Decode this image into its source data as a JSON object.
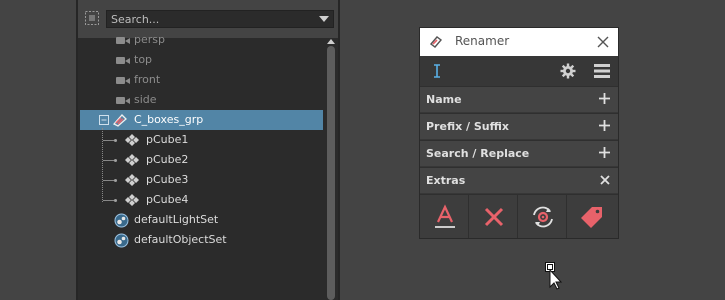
{
  "outliner": {
    "search": {
      "placeholder": "Search..."
    },
    "items": [
      {
        "label": "persp",
        "kind": "camera",
        "dim": true
      },
      {
        "label": "top",
        "kind": "camera",
        "dim": true
      },
      {
        "label": "front",
        "kind": "camera",
        "dim": true
      },
      {
        "label": "side",
        "kind": "camera",
        "dim": true
      },
      {
        "label": "C_boxes_grp",
        "kind": "group",
        "selected": true
      },
      {
        "label": "pCube1",
        "kind": "mesh"
      },
      {
        "label": "pCube2",
        "kind": "mesh"
      },
      {
        "label": "pCube3",
        "kind": "mesh"
      },
      {
        "label": "pCube4",
        "kind": "mesh"
      },
      {
        "label": "defaultLightSet",
        "kind": "set"
      },
      {
        "label": "defaultObjectSet",
        "kind": "set"
      }
    ],
    "selection_color": "#5285a6"
  },
  "renamer": {
    "title": "Renamer",
    "sections": [
      {
        "label": "Name",
        "icon": "plus-icon"
      },
      {
        "label": "Prefix / Suffix",
        "icon": "plus-icon"
      },
      {
        "label": "Search / Replace",
        "icon": "plus-icon"
      },
      {
        "label": "Extras",
        "icon": "close-icon"
      }
    ],
    "actions": [
      {
        "name": "underline-text-icon"
      },
      {
        "name": "delete-x-icon"
      },
      {
        "name": "refresh-gear-icon"
      },
      {
        "name": "tag-icon"
      }
    ],
    "accent_color": "#e8626a",
    "cursor_icon_color": "#5ab0e6"
  }
}
